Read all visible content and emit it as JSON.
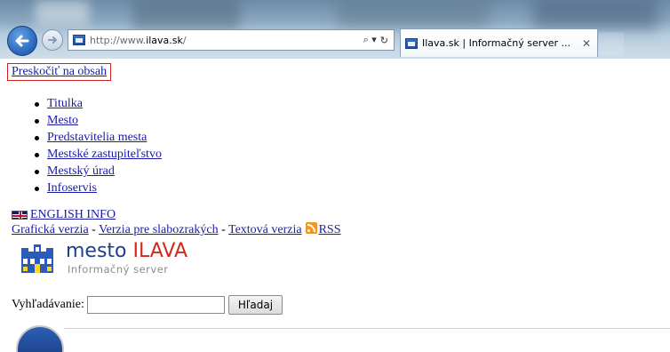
{
  "browser": {
    "url_prefix": "http://www.",
    "url_host": "ilava.sk",
    "url_suffix": "/",
    "tab_title": "Ilava.sk | Informačný server ...",
    "search_glyph": "⌕ ▾",
    "refresh_glyph": "↻",
    "close_glyph": "✕"
  },
  "page": {
    "skip_link": "Preskočiť na obsah",
    "nav": [
      "Titulka",
      "Mesto",
      "Predstavitelia mesta",
      "Mestské zastupiteľstvo",
      "Mestský úrad",
      "Infoservis"
    ],
    "english_link": "ENGLISH INFO",
    "versions": {
      "graphic": "Grafická verzia",
      "visually_impaired": "Verzia pre slabozrakých",
      "text": "Textová verzia",
      "rss": "RSS",
      "separator": " - "
    },
    "logo": {
      "word1": "mesto ",
      "word2": "ILAVA",
      "subtitle": "Informačný server"
    },
    "search": {
      "label": "Vyhľadávanie:",
      "value": "",
      "button": "Hľadaj"
    }
  },
  "colors": {
    "link": "#1a1aa6",
    "logo_blue": "#1f3f8c",
    "logo_red": "#d2281e",
    "skip_border": "#d02020"
  },
  "icons": {
    "back": "arrow-left-icon",
    "forward": "arrow-right-icon",
    "favicon": "ilava-crest-icon",
    "flag": "uk-flag-icon",
    "rss": "rss-icon"
  }
}
